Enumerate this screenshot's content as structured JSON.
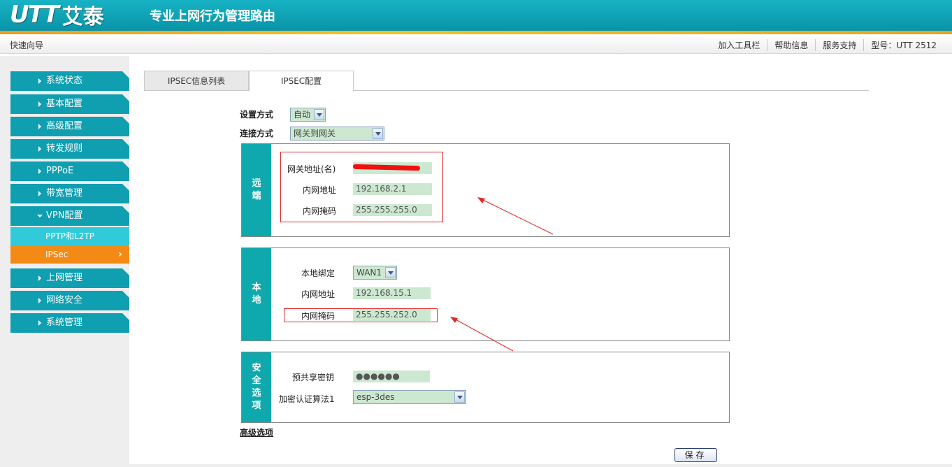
{
  "header": {
    "logo_latin": "UTT",
    "logo_cn": "艾泰",
    "title": "专业上网行为管理路由"
  },
  "subbar": {
    "quick_guide": "快速向导",
    "links": [
      "加入工具栏",
      "帮助信息",
      "服务支持",
      "型号：UTT 2512"
    ]
  },
  "sidebar": {
    "items": [
      {
        "label": "系统状态"
      },
      {
        "label": "基本配置"
      },
      {
        "label": "高级配置"
      },
      {
        "label": "转发规则"
      },
      {
        "label": "PPPoE"
      },
      {
        "label": "带宽管理"
      },
      {
        "label": "VPN配置"
      },
      {
        "label": "上网管理"
      },
      {
        "label": "网络安全"
      },
      {
        "label": "系统管理"
      }
    ],
    "vpn_sub": {
      "pptp": "PPTP和L2TP",
      "ipsec": "IPSec",
      "chevron": "›"
    }
  },
  "tabs": {
    "list": "IPSEC信息列表",
    "config": "IPSEC配置"
  },
  "form": {
    "setup_mode_label": "设置方式",
    "setup_mode_value": "自动",
    "conn_mode_label": "连接方式",
    "conn_mode_value": "网关到网关",
    "remote": {
      "side_1": "远",
      "side_2": "端",
      "gateway_label": "网关地址(名)",
      "gateway_value": "",
      "lan_addr_label": "内网地址",
      "lan_addr_value": "192.168.2.1",
      "lan_mask_label": "内网掩码",
      "lan_mask_value": "255.255.255.0"
    },
    "local": {
      "side_1": "本",
      "side_2": "地",
      "bind_label": "本地绑定",
      "bind_value": "WAN1",
      "lan_addr_label": "内网地址",
      "lan_addr_value": "192.168.15.1",
      "lan_mask_label": "内网掩码",
      "lan_mask_value": "255.255.252.0"
    },
    "security": {
      "side_1": "安",
      "side_2": "全",
      "side_3": "选",
      "side_4": "项",
      "psk_label": "预共享密钥",
      "psk_value": "●●●●●●",
      "algo_label": "加密认证算法1",
      "algo_value": "esp-3des"
    },
    "advanced_link": "高级选项",
    "save_button": "保存"
  },
  "colors": {
    "header_teal": "#0a93a8",
    "nav_teal": "#0f9fb1",
    "active_orange": "#f48a16",
    "sub_cyan": "#30cadb",
    "input_green": "#cde8d0",
    "annotation_red": "#e02a2a"
  }
}
